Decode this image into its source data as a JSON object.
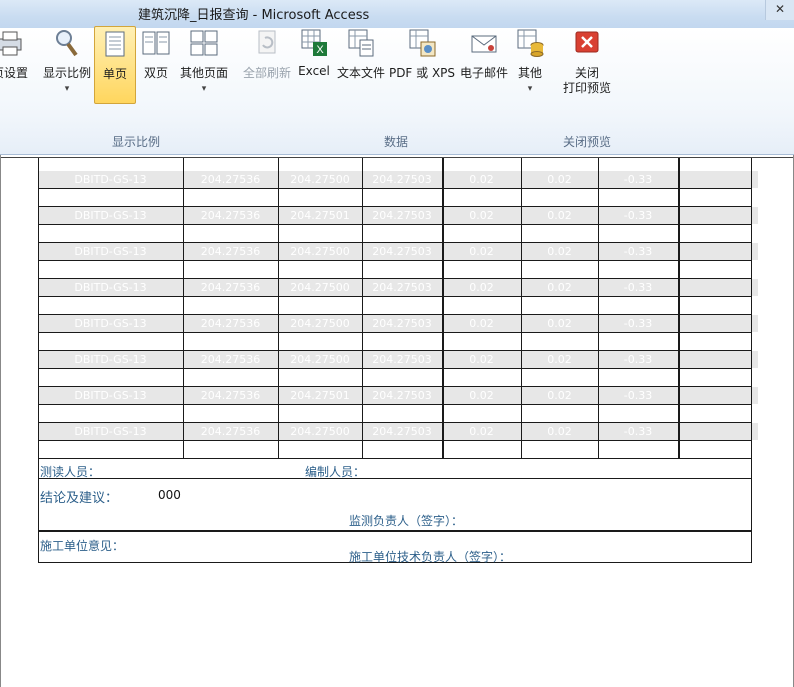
{
  "window": {
    "title": "建筑沉降_日报查询 - Microsoft Access",
    "close_glyph": "✕"
  },
  "ribbon": {
    "page_setup_partial": "页设置",
    "zoom_label": "显示比例",
    "one_page_label": "单页",
    "two_page_label": "双页",
    "more_pages_label": "其他页面",
    "refresh_all_label": "全部刷新",
    "excel_label": "Excel",
    "text_file_label": "文本文件",
    "pdf_xps_label": "PDF 或 XPS",
    "email_label": "电子邮件",
    "more_label": "其他",
    "close_preview_line1": "关闭",
    "close_preview_line2": "打印预览",
    "group_zoom": "显示比例",
    "group_data": "数据",
    "group_close": "关闭预览",
    "dropdown_arrow": "▾"
  },
  "report": {
    "rows": [
      {
        "point": "DBITD-GS-13",
        "v1": "204.27536",
        "v2": "204.27500",
        "v3": "204.27503",
        "d1": "0.02",
        "d2": "0.02",
        "d3": "-0.33"
      },
      {
        "point": "DBITD-GS-13",
        "v1": "204.27536",
        "v2": "204.27501",
        "v3": "204.27503",
        "d1": "0.02",
        "d2": "0.02",
        "d3": "-0.33"
      },
      {
        "point": "DBITD-GS-13",
        "v1": "204.27536",
        "v2": "204.27500",
        "v3": "204.27503",
        "d1": "0.02",
        "d2": "0.02",
        "d3": "-0.33"
      },
      {
        "point": "DBITD-GS-13",
        "v1": "204.27536",
        "v2": "204.27500",
        "v3": "204.27503",
        "d1": "0.02",
        "d2": "0.02",
        "d3": "-0.33"
      },
      {
        "point": "DBITD-GS-13",
        "v1": "204.27536",
        "v2": "204.27500",
        "v3": "204.27503",
        "d1": "0.02",
        "d2": "0.02",
        "d3": "-0.33"
      },
      {
        "point": "DBITD-GS-13",
        "v1": "204.27536",
        "v2": "204.27500",
        "v3": "204.27503",
        "d1": "0.02",
        "d2": "0.02",
        "d3": "-0.33"
      },
      {
        "point": "DBITD-GS-13",
        "v1": "204.27536",
        "v2": "204.27501",
        "v3": "204.27503",
        "d1": "0.02",
        "d2": "0.02",
        "d3": "-0.33"
      },
      {
        "point": "DBITD-GS-13",
        "v1": "204.27536",
        "v2": "204.27500",
        "v3": "204.27503",
        "d1": "0.02",
        "d2": "0.02",
        "d3": "-0.33"
      }
    ],
    "surveyor_label": "测读人员：",
    "editor_label": "编制人员：",
    "conclusion_label": "结论及建议：",
    "conclusion_value": "000",
    "monitor_sign_label": "监测负责人（签字）：",
    "contractor_opinion_label": "施工单位意见：",
    "contractor_sign_label": "施工单位技术负责人（签字）："
  },
  "colors": {
    "accent": "#ffd65e",
    "label_blue": "#2c5f8a"
  }
}
